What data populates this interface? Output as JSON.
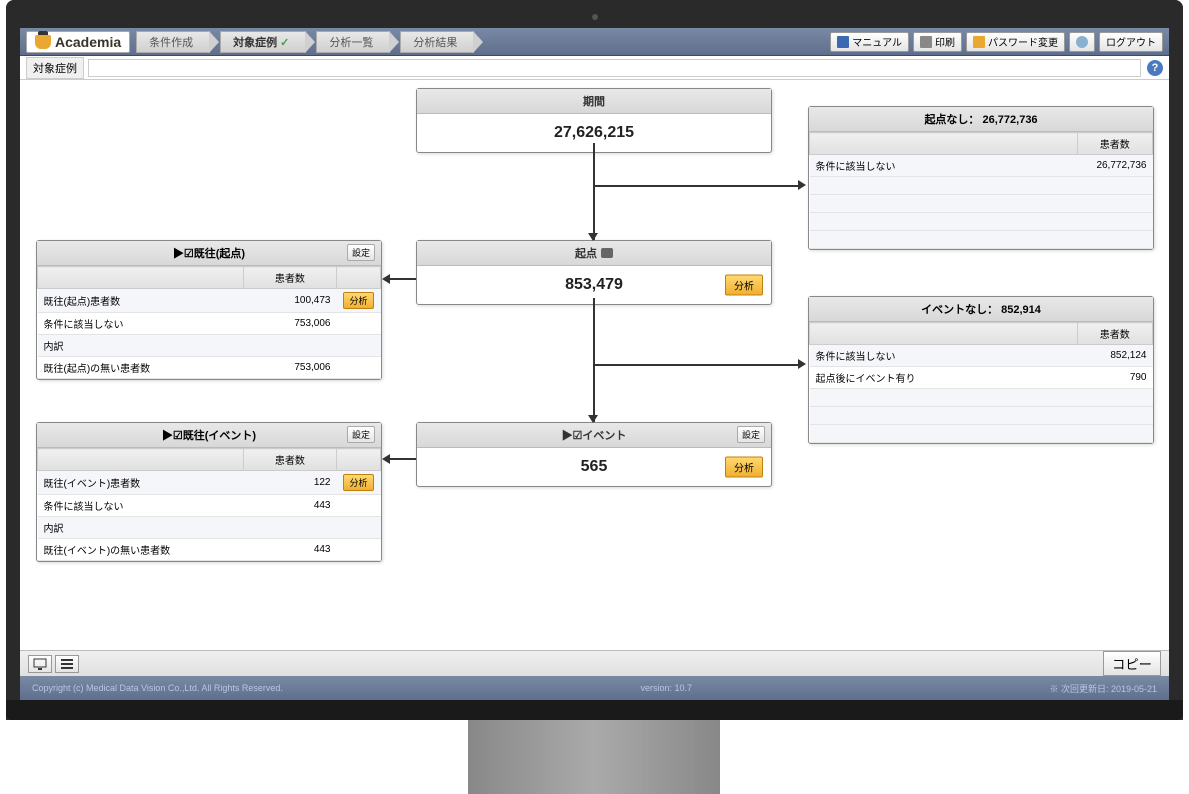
{
  "app": {
    "name": "Academia"
  },
  "breadcrumb": [
    {
      "label": "条件作成"
    },
    {
      "label": "対象症例",
      "check": true
    },
    {
      "label": "分析一覧"
    },
    {
      "label": "分析結果"
    }
  ],
  "topbuttons": {
    "manual": "マニュアル",
    "print": "印刷",
    "password": "パスワード変更",
    "logout": "ログアウト"
  },
  "filter": {
    "label": "対象症例",
    "value": ""
  },
  "nodes": {
    "period": {
      "title": "期間",
      "value": "27,626,215"
    },
    "start": {
      "title": "起点",
      "value": "853,479"
    },
    "event": {
      "title": "▶☑イベント",
      "value": "565"
    }
  },
  "panels": {
    "exist_start": {
      "title": "▶☑既往(起点)",
      "col": "患者数",
      "rows": [
        {
          "label": "既往(起点)患者数",
          "val": "100,473",
          "act": true
        },
        {
          "label": "条件に該当しない",
          "val": "753,006"
        },
        {
          "label": "内訳",
          "val": ""
        },
        {
          "label": "既往(起点)の無い患者数",
          "val": "753,006"
        }
      ]
    },
    "exist_event": {
      "title": "▶☑既往(イベント)",
      "col": "患者数",
      "rows": [
        {
          "label": "既往(イベント)患者数",
          "val": "122",
          "act": true
        },
        {
          "label": "条件に該当しない",
          "val": "443"
        },
        {
          "label": "内訳",
          "val": ""
        },
        {
          "label": "既往(イベント)の無い患者数",
          "val": "443"
        }
      ]
    },
    "no_start": {
      "title": "起点なし：",
      "title_val": "26,772,736",
      "col": "患者数",
      "rows": [
        {
          "label": "条件に該当しない",
          "val": "26,772,736"
        }
      ]
    },
    "no_event": {
      "title": "イベントなし：",
      "title_val": "852,914",
      "col": "患者数",
      "rows": [
        {
          "label": "条件に該当しない",
          "val": "852,124"
        },
        {
          "label": "起点後にイベント有り",
          "val": "790"
        }
      ]
    }
  },
  "buttons": {
    "analyze": "分析",
    "edit": "設定",
    "copy": "コピー"
  },
  "footer": {
    "copyright": "Copyright (c) Medical Data Vision Co.,Ltd. All Rights Reserved.",
    "version": "version: 10.7",
    "update": "※ 次回更新日: 2019-05-21"
  }
}
